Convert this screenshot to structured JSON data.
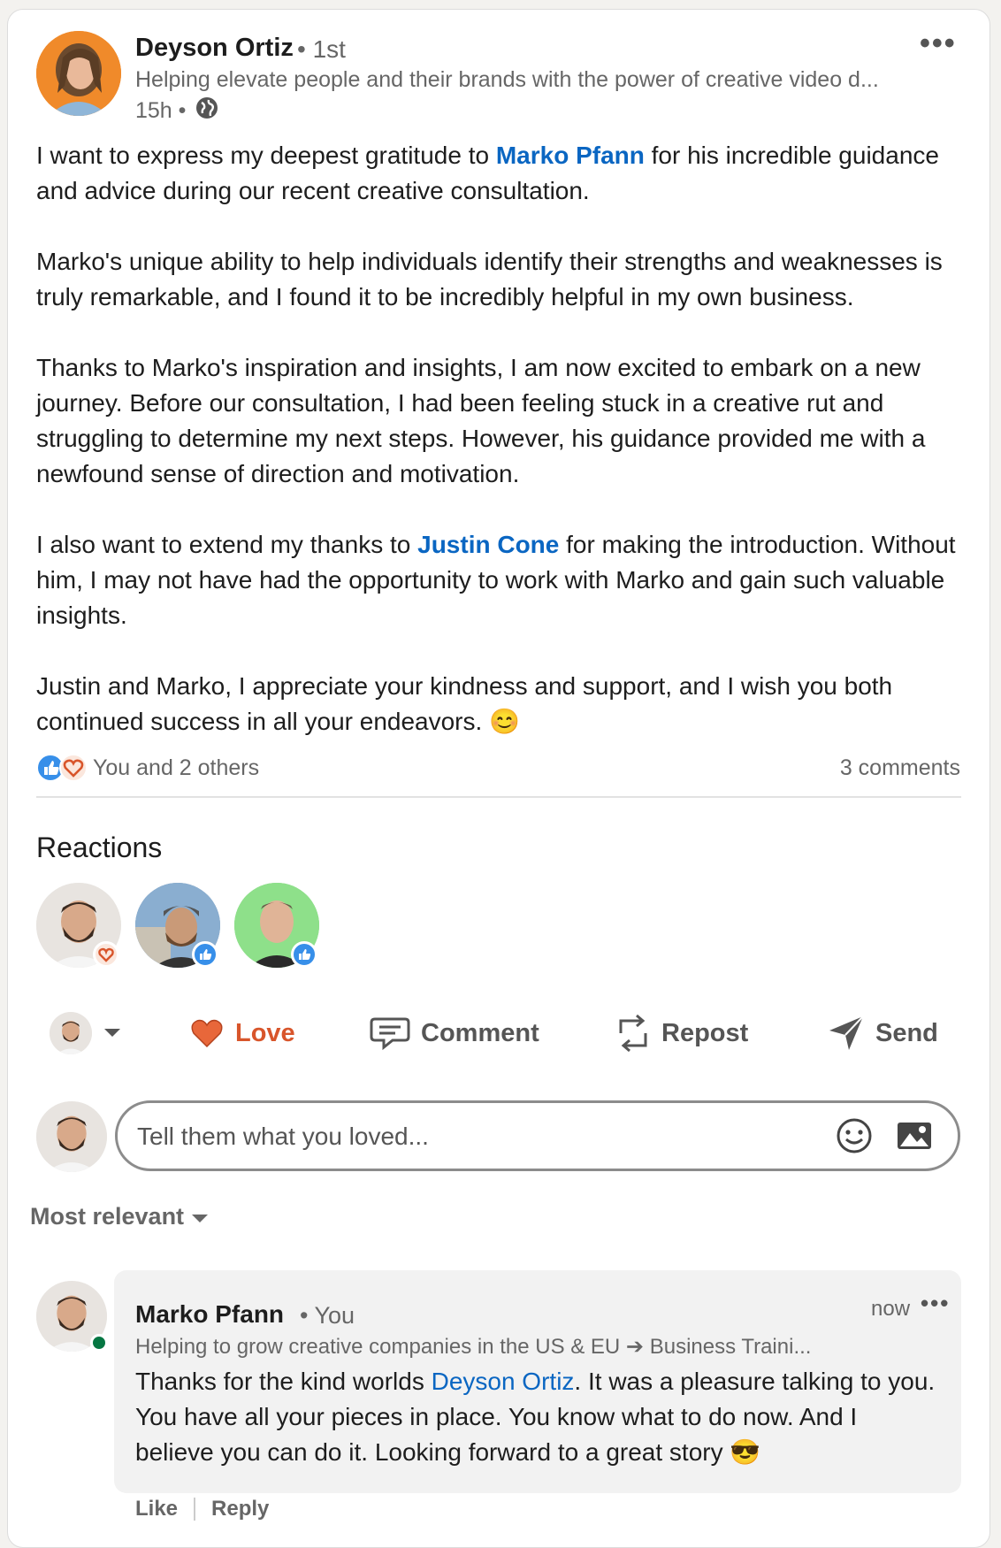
{
  "post": {
    "author": {
      "name": "Deyson Ortiz",
      "degree": "• 1st",
      "headline": "Helping elevate people and their brands with the power of creative video d...",
      "time": "15h •"
    },
    "body": {
      "p1_a": "I want to express my deepest gratitude to ",
      "p1_mention": "Marko Pfann",
      "p1_b": " for his incredible guidance and advice during our recent creative consultation.",
      "p2": "Marko's unique ability to help individuals identify their strengths and weaknesses is truly remarkable, and I found it to be incredibly helpful in my own business.",
      "p3": "Thanks to Marko's inspiration and insights, I am now excited to embark on a new journey. Before our consultation, I had been feeling stuck in a creative rut and struggling to determine my next steps. However, his guidance provided me with a newfound sense of direction and motivation.",
      "p4_a": "I also want to extend my thanks to ",
      "p4_mention": "Justin Cone",
      "p4_b": " for making the introduction. Without him, I may not have had the opportunity to work with Marko and gain such valuable insights.",
      "p5": "Justin and Marko, I appreciate your kindness and support, and I wish you both continued success in all your endeavors. 😊"
    },
    "reactions_summary": "You and 2 others",
    "comments_count": "3 comments"
  },
  "reactions": {
    "title": "Reactions",
    "people": [
      {
        "reaction": "love"
      },
      {
        "reaction": "like"
      },
      {
        "reaction": "like"
      }
    ]
  },
  "actions": {
    "love": "Love",
    "comment": "Comment",
    "repost": "Repost",
    "send": "Send"
  },
  "composer": {
    "placeholder": "Tell them what you loved..."
  },
  "sort": {
    "label": "Most relevant"
  },
  "comment": {
    "author": "Marko Pfann",
    "badge": "• You",
    "headline": "Helping to grow creative companies in the US & EU ➔ Business Traini...",
    "time": "now",
    "text_a": "Thanks for the kind worlds ",
    "mention": "Deyson Ortiz",
    "text_b": ". It was a pleasure talking to you. You have all your pieces in place. You know what to do now. And I believe you can do it. Looking forward to a great story 😎",
    "like": "Like",
    "reply": "Reply"
  },
  "colors": {
    "link": "#0a66c2",
    "love": "#d8552b",
    "like": "#378fe9",
    "online": "#057642"
  }
}
